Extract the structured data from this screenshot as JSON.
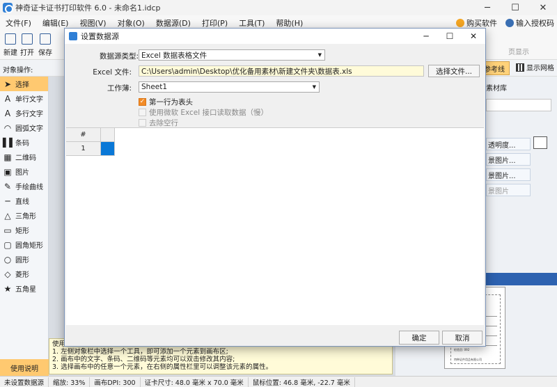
{
  "app": {
    "title": "神奇证卡证书打印软件 6.0 - 未命名1.idcp"
  },
  "menu": {
    "items": [
      "文件(F)",
      "编辑(E)",
      "视图(V)",
      "对象(O)",
      "数据源(D)",
      "打印(P)",
      "工具(T)",
      "帮助(H)"
    ],
    "buy": "购买软件",
    "license": "输入授权码"
  },
  "toolbar": {
    "new": "新建",
    "open": "打开",
    "save": "保存",
    "right": "页显示"
  },
  "objbar": {
    "label": "对象操作:",
    "ref": "参考线",
    "grid": "显示网格"
  },
  "tools": [
    {
      "icon": "cursor-icon",
      "glyph": "➤",
      "label": "选择"
    },
    {
      "icon": "text-icon",
      "glyph": "A",
      "label": "单行文字"
    },
    {
      "icon": "multiline-icon",
      "glyph": "A",
      "label": "多行文字"
    },
    {
      "icon": "arc-text-icon",
      "glyph": "◠",
      "label": "圆弧文字"
    },
    {
      "icon": "barcode-icon",
      "glyph": "▌▌",
      "label": "条码"
    },
    {
      "icon": "qrcode-icon",
      "glyph": "▦",
      "label": "二维码"
    },
    {
      "icon": "image-icon",
      "glyph": "▣",
      "label": "图片"
    },
    {
      "icon": "pen-icon",
      "glyph": "✎",
      "label": "手绘曲线"
    },
    {
      "icon": "line-icon",
      "glyph": "─",
      "label": "直线"
    },
    {
      "icon": "triangle-icon",
      "glyph": "△",
      "label": "三角形"
    },
    {
      "icon": "rect-icon",
      "glyph": "▭",
      "label": "矩形"
    },
    {
      "icon": "round-rect-icon",
      "glyph": "▢",
      "label": "圆角矩形"
    },
    {
      "icon": "circle-icon",
      "glyph": "○",
      "label": "圆形"
    },
    {
      "icon": "diamond-icon",
      "glyph": "◇",
      "label": "菱形"
    },
    {
      "icon": "star-icon",
      "glyph": "★",
      "label": "五角星"
    }
  ],
  "help_button": "使用说明",
  "rightpanel": {
    "tab": "素材库",
    "btn_opacity": "透明度...",
    "btn_bg1": "景图片...",
    "btn_bg2": "景图片...",
    "btn_bg3": "景图片",
    "preview_lines": [
      "检验员: 092",
      "特种证件用品有限公司"
    ]
  },
  "helptip": {
    "title": "使用",
    "lines": [
      "1. 左侧对象栏中选择一个工具，即可添加一个元素到画布区;",
      "2. 画布中的文字、条码、二维码等元素均可以双击修改其内容;",
      "3. 选择画布中的任意一个元素，在右侧的属性栏里可以调整该元素的属性。"
    ]
  },
  "status": {
    "datasource": "未设置数据源",
    "zoom": "缩放: 33%",
    "dpi": "画布DPI: 300",
    "size": "证卡尺寸: 48.0 毫米 x 70.0 毫米",
    "mouse": "鼠标位置: 46.8 毫米, -22.7 毫米"
  },
  "dialog": {
    "title": "设置数据源",
    "source_type_label": "数据源类型:",
    "source_type_value": "Excel 数据表格文件",
    "file_label": "Excel 文件:",
    "file_path": "C:\\Users\\admin\\Desktop\\优化备用素材\\新建文件夹\\数据表.xls",
    "choose_button": "选择文件...",
    "sheet_label": "工作薄:",
    "sheet_value": "Sheet1",
    "chk_header": "第一行为表头",
    "chk_ms_excel": "使用微软 Excel 接口读取数据（慢）",
    "chk_remove_empty": "去除空行",
    "grid_header": "#",
    "grid_row1": "1",
    "ok": "确定",
    "cancel": "取消"
  }
}
